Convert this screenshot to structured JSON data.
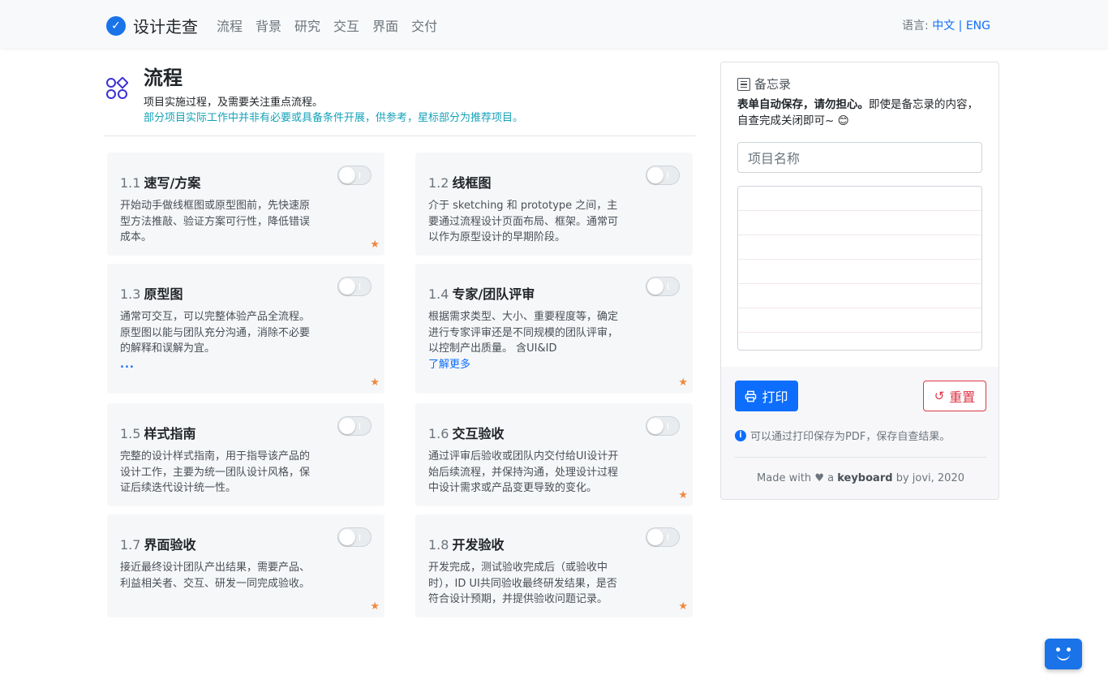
{
  "navbar": {
    "brand": "设计走查",
    "links": [
      "流程",
      "背景",
      "研究",
      "交互",
      "界面",
      "交付"
    ],
    "lang_label": "语言:",
    "lang_zh": "中文",
    "lang_sep": "|",
    "lang_en": "ENG"
  },
  "section": {
    "title": "流程",
    "subtitle": "项目实施过程，及需要关注重点流程。",
    "note": "部分项目实际工作中并非有必要或具备条件开展，供参考，星标部分为推荐项目。"
  },
  "cards": [
    {
      "num": "1.1",
      "title": "速写/方案",
      "desc": "开始动手做线框图或原型图前，先快速原型方法推敲、验证方案可行性，降低错误成本。",
      "starred": true
    },
    {
      "num": "1.2",
      "title": "线框图",
      "desc": "介于 sketching 和 prototype 之间，主要通过流程设计页面布局、框架。通常可以作为原型设计的早期阶段。",
      "starred": false
    },
    {
      "num": "1.3",
      "title": "原型图",
      "desc": "通常可交互，可以完整体验产品全流程。原型图以能与团队充分沟通，消除不必要的解释和误解为宜。",
      "extra": "...",
      "starred": true
    },
    {
      "num": "1.4",
      "title": "专家/团队评审",
      "desc": "根据需求类型、大小、重要程度等，确定进行专家评审还是不同规模的团队评审，以控制产出质量。 含UI&ID",
      "link": "了解更多",
      "starred": true
    },
    {
      "num": "1.5",
      "title": "样式指南",
      "desc": "完整的设计样式指南，用于指导该产品的设计工作，主要为统一团队设计风格，保证后续迭代设计统一性。",
      "starred": false
    },
    {
      "num": "1.6",
      "title": "交互验收",
      "desc": "通过评审后验收或团队内交付给UI设计开始后续流程，并保持沟通，处理设计过程中设计需求或产品变更导致的变化。",
      "starred": true
    },
    {
      "num": "1.7",
      "title": "界面验收",
      "desc": "接近最终设计团队产出结果，需要产品、利益相关者、交互、研发一同完成验收。",
      "starred": true
    },
    {
      "num": "1.8",
      "title": "开发验收",
      "desc": "开发完成，测试验收完成后（或验收中时），ID UI共同验收最终研发结果，是否符合设计预期，并提供验收问题记录。",
      "starred": true
    }
  ],
  "memo": {
    "title": "备忘录",
    "tip_bold": "表单自动保存，请勿担心。",
    "tip_rest": "即使是备忘录的内容，自查完成关闭即可~ 😊",
    "project_placeholder": "项目名称",
    "print_label": "打印",
    "reset_label": "重置",
    "pdf_note": "可以通过打印保存为PDF，保存自查结果。",
    "made_prefix": "Made with",
    "made_a": "a",
    "made_keyboard": "keyboard",
    "made_suffix": "by jovi, 2020"
  },
  "colors": {
    "primary": "#0d6efd",
    "brand_check": "#1a73e8",
    "danger": "#dc3545",
    "star": "#f0883e",
    "note": "#17a2b8"
  }
}
